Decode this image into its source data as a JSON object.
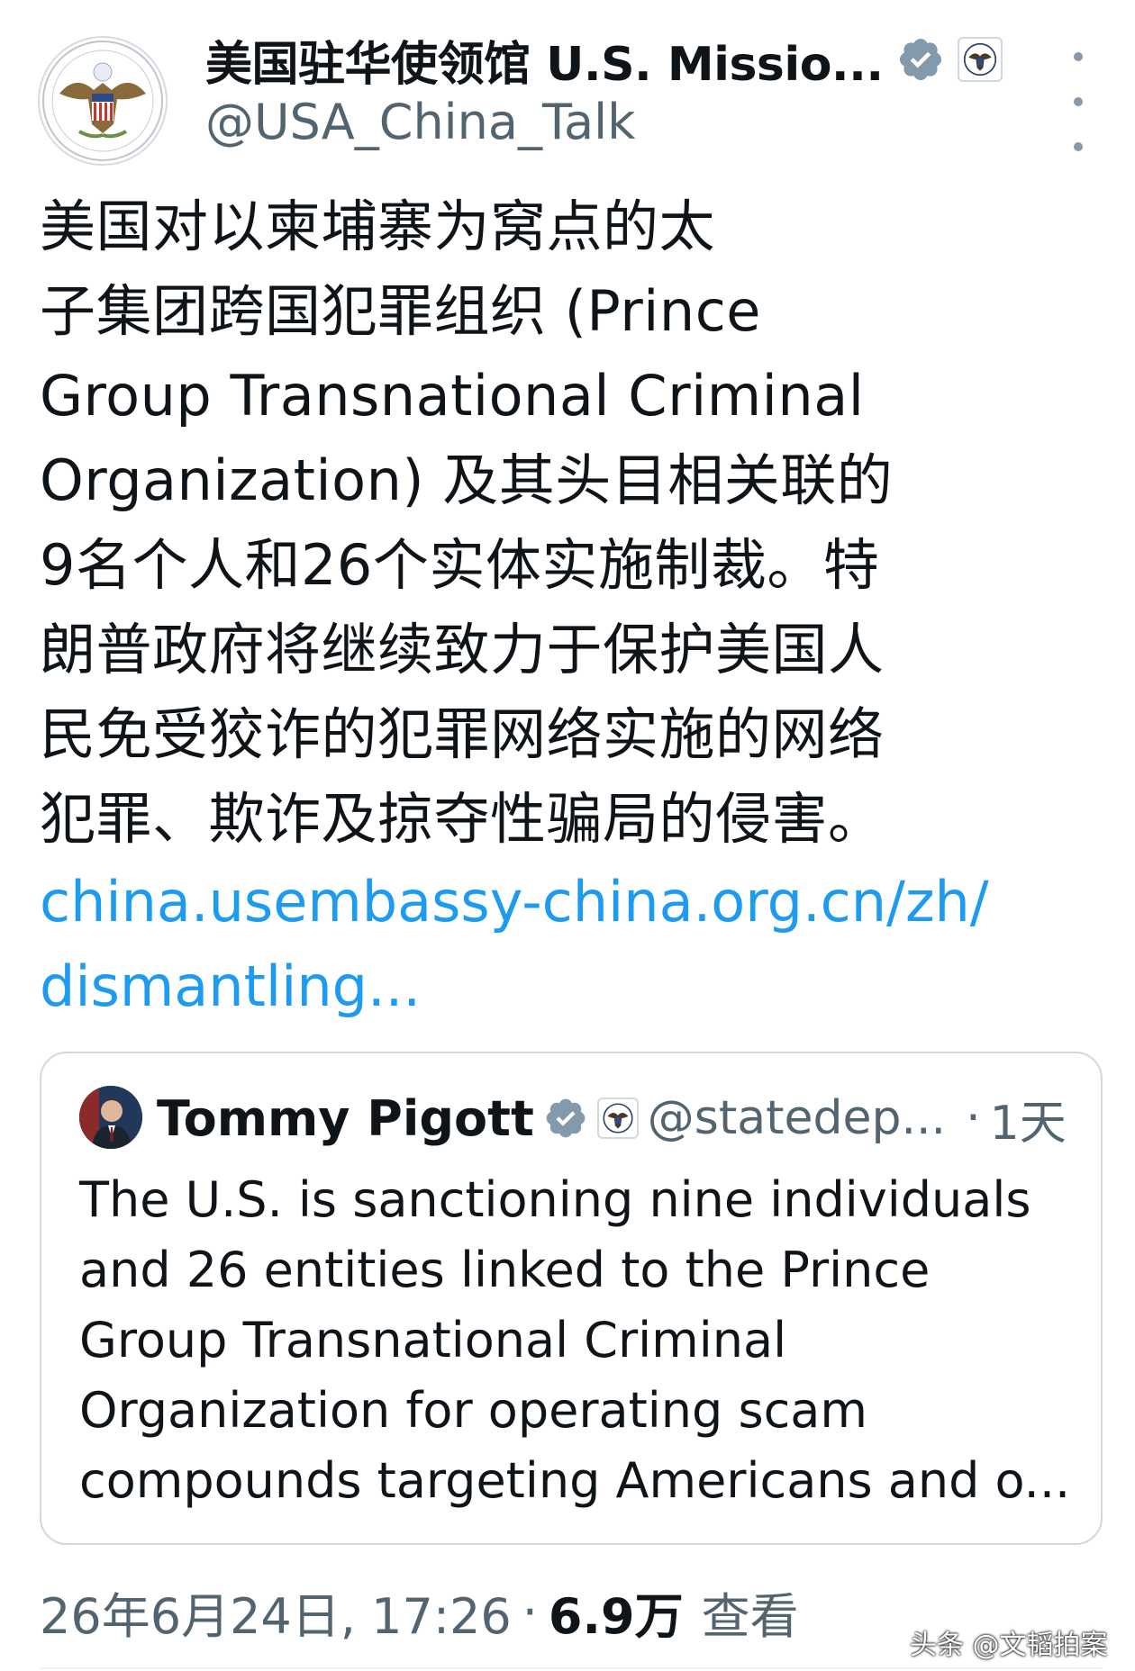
{
  "author": {
    "display_name": "美国驻华使领馆 U.S. Missio...",
    "handle": "@USA_China_Talk",
    "avatar_icon": "us-embassy-seal-icon",
    "verified_icon": "verified-badge-icon",
    "affiliation_icon": "state-department-seal-icon"
  },
  "tweet": {
    "text": "美国对以柬埔寨为窝点的太\n子集团跨国犯罪组织 (Prince\nGroup Transnational Criminal\nOrganization) 及其头目相关联的\n9名个人和26个实体实施制裁。特\n朗普政府将继续致力于保护美国人\n民免受狡诈的犯罪网络实施的网络\n犯罪、欺诈及掠夺性骗局的侵害。",
    "link": "china.usembassy-china.org.cn/zh/\ndismantling..."
  },
  "quote": {
    "name": "Tommy Pigott",
    "handle": "@statedep...",
    "separator": "·",
    "time": "1天",
    "text": "The U.S. is sanctioning nine individuals\nand 26 entities linked to the Prince\nGroup Transnational Criminal\nOrganization for operating scam\ncompounds targeting Americans and o..."
  },
  "meta": {
    "date": "26年6月24日, 17:26",
    "separator": "·",
    "views_count": "6.9万",
    "views_label": "查看"
  },
  "watermark": "头条 @文韬拍案",
  "colors": {
    "link": "#1d9bf0",
    "verified": "#829aab",
    "secondary_text": "#536471"
  }
}
